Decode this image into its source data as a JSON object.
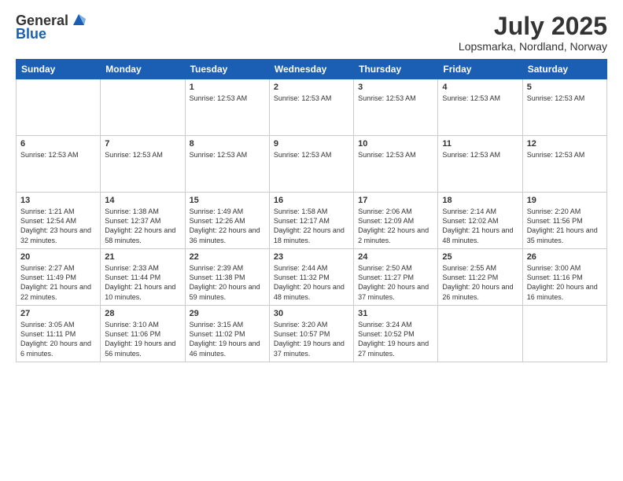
{
  "header": {
    "logo_line1": "General",
    "logo_line2": "Blue",
    "month_year": "July 2025",
    "location": "Lopsmarka, Nordland, Norway"
  },
  "weekdays": [
    "Sunday",
    "Monday",
    "Tuesday",
    "Wednesday",
    "Thursday",
    "Friday",
    "Saturday"
  ],
  "weeks": [
    [
      {
        "day": "",
        "info": ""
      },
      {
        "day": "",
        "info": ""
      },
      {
        "day": "1",
        "info": "Sunrise: 12:53 AM"
      },
      {
        "day": "2",
        "info": "Sunrise: 12:53 AM"
      },
      {
        "day": "3",
        "info": "Sunrise: 12:53 AM"
      },
      {
        "day": "4",
        "info": "Sunrise: 12:53 AM"
      },
      {
        "day": "5",
        "info": "Sunrise: 12:53 AM"
      }
    ],
    [
      {
        "day": "6",
        "info": "Sunrise: 12:53 AM"
      },
      {
        "day": "7",
        "info": "Sunrise: 12:53 AM"
      },
      {
        "day": "8",
        "info": "Sunrise: 12:53 AM"
      },
      {
        "day": "9",
        "info": "Sunrise: 12:53 AM"
      },
      {
        "day": "10",
        "info": "Sunrise: 12:53 AM"
      },
      {
        "day": "11",
        "info": "Sunrise: 12:53 AM"
      },
      {
        "day": "12",
        "info": "Sunrise: 12:53 AM"
      }
    ],
    [
      {
        "day": "13",
        "info": "Sunrise: 1:21 AM\nSunset: 12:54 AM\nDaylight: 23 hours and 32 minutes."
      },
      {
        "day": "14",
        "info": "Sunrise: 1:38 AM\nSunset: 12:37 AM\nDaylight: 22 hours and 58 minutes."
      },
      {
        "day": "15",
        "info": "Sunrise: 1:49 AM\nSunset: 12:26 AM\nDaylight: 22 hours and 36 minutes."
      },
      {
        "day": "16",
        "info": "Sunrise: 1:58 AM\nSunset: 12:17 AM\nDaylight: 22 hours and 18 minutes."
      },
      {
        "day": "17",
        "info": "Sunrise: 2:06 AM\nSunset: 12:09 AM\nDaylight: 22 hours and 2 minutes."
      },
      {
        "day": "18",
        "info": "Sunrise: 2:14 AM\nSunset: 12:02 AM\nDaylight: 21 hours and 48 minutes."
      },
      {
        "day": "19",
        "info": "Sunrise: 2:20 AM\nSunset: 11:56 PM\nDaylight: 21 hours and 35 minutes."
      }
    ],
    [
      {
        "day": "20",
        "info": "Sunrise: 2:27 AM\nSunset: 11:49 PM\nDaylight: 21 hours and 22 minutes."
      },
      {
        "day": "21",
        "info": "Sunrise: 2:33 AM\nSunset: 11:44 PM\nDaylight: 21 hours and 10 minutes."
      },
      {
        "day": "22",
        "info": "Sunrise: 2:39 AM\nSunset: 11:38 PM\nDaylight: 20 hours and 59 minutes."
      },
      {
        "day": "23",
        "info": "Sunrise: 2:44 AM\nSunset: 11:32 PM\nDaylight: 20 hours and 48 minutes."
      },
      {
        "day": "24",
        "info": "Sunrise: 2:50 AM\nSunset: 11:27 PM\nDaylight: 20 hours and 37 minutes."
      },
      {
        "day": "25",
        "info": "Sunrise: 2:55 AM\nSunset: 11:22 PM\nDaylight: 20 hours and 26 minutes."
      },
      {
        "day": "26",
        "info": "Sunrise: 3:00 AM\nSunset: 11:16 PM\nDaylight: 20 hours and 16 minutes."
      }
    ],
    [
      {
        "day": "27",
        "info": "Sunrise: 3:05 AM\nSunset: 11:11 PM\nDaylight: 20 hours and 6 minutes."
      },
      {
        "day": "28",
        "info": "Sunrise: 3:10 AM\nSunset: 11:06 PM\nDaylight: 19 hours and 56 minutes."
      },
      {
        "day": "29",
        "info": "Sunrise: 3:15 AM\nSunset: 11:02 PM\nDaylight: 19 hours and 46 minutes."
      },
      {
        "day": "30",
        "info": "Sunrise: 3:20 AM\nSunset: 10:57 PM\nDaylight: 19 hours and 37 minutes."
      },
      {
        "day": "31",
        "info": "Sunrise: 3:24 AM\nSunset: 10:52 PM\nDaylight: 19 hours and 27 minutes."
      },
      {
        "day": "",
        "info": ""
      },
      {
        "day": "",
        "info": ""
      }
    ]
  ]
}
